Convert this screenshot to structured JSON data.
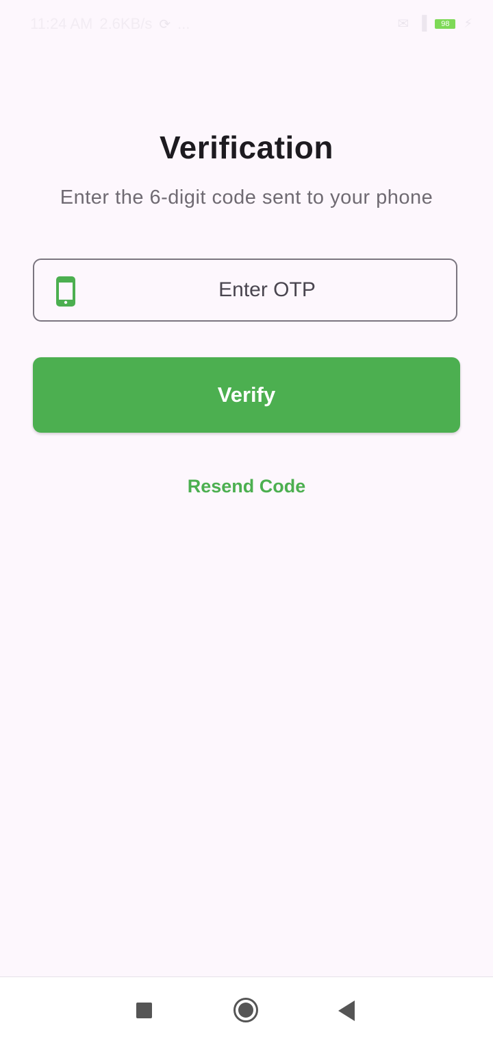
{
  "status_bar": {
    "time": "11:24 AM",
    "network_speed": "2.6KB/s",
    "dots": "...",
    "battery_level": "98",
    "icons": [
      "sync-icon",
      "message-icon",
      "signal-icon",
      "battery-icon",
      "charging-icon"
    ]
  },
  "verification": {
    "title": "Verification",
    "subtitle": "Enter the 6-digit code sent to your phone"
  },
  "otp_field": {
    "placeholder": "Enter OTP",
    "value": "",
    "icon": "phone-icon"
  },
  "verify_button": {
    "label": "Verify"
  },
  "resend": {
    "label": "Resend Code"
  },
  "nav_bar": {
    "icons": [
      "recents-icon",
      "home-icon",
      "back-icon"
    ]
  },
  "colors": {
    "accent": "#4caf50",
    "background": "#fdf7fd",
    "title": "#1d1b20",
    "subtitle": "#6f6a72",
    "field_border": "#7a757f"
  }
}
